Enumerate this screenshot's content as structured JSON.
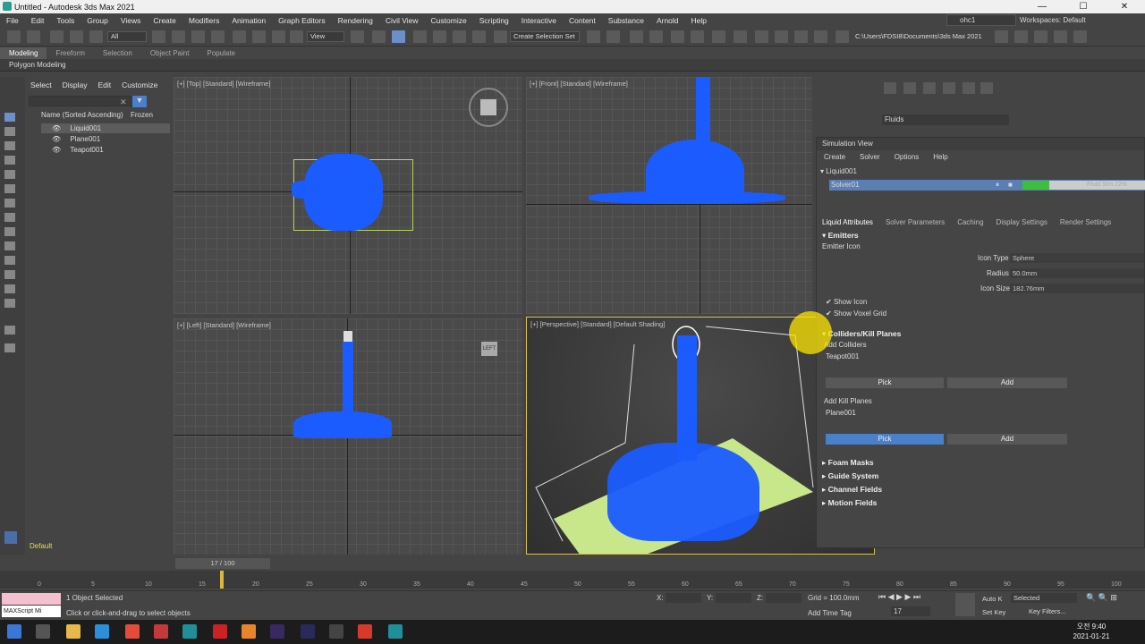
{
  "title": "Untitled - Autodesk 3ds Max 2021",
  "window_controls": [
    "—",
    "☐",
    "✕"
  ],
  "menu": [
    "File",
    "Edit",
    "Tools",
    "Group",
    "Views",
    "Create",
    "Modifiers",
    "Animation",
    "Graph Editors",
    "Rendering",
    "Civil View",
    "Customize",
    "Scripting",
    "Interactive",
    "Content",
    "Substance",
    "Arnold",
    "Help"
  ],
  "user": "ohc1",
  "workspace_label": "Workspaces:",
  "workspace_value": "Default",
  "toolbar": {
    "filter": "All",
    "view": "View",
    "selection_set": "Create Selection Set",
    "path": "C:\\Users\\FDSI8\\Documents\\3ds Max 2021"
  },
  "ribbon": {
    "tabs": [
      "Modeling",
      "Freeform",
      "Selection",
      "Object Paint",
      "Populate"
    ],
    "active": "Modeling",
    "sub": "Polygon Modeling"
  },
  "scene_explorer": {
    "menu": [
      "Select",
      "Display",
      "Edit",
      "Customize"
    ],
    "col_name": "Name (Sorted Ascending)",
    "col_frozen": "Frozen",
    "rows": [
      "Liquid001",
      "Plane001",
      "Teapot001"
    ],
    "layer": "Default"
  },
  "viewports": {
    "top": "[+] [Top] [Standard] [Wireframe]",
    "front": "[+] [Front] [Standard] [Wireframe]",
    "left": "[+] [Left] [Standard] [Wireframe]",
    "persp": "[+] [Perspective] [Standard] [Default Shading]",
    "viewcube_left": "LEFT"
  },
  "command_panel": {
    "category": "Fluids"
  },
  "sim_view": {
    "title": "Simulation View",
    "menu": [
      "Create",
      "Solver",
      "Options",
      "Help"
    ],
    "tree_parent": "Liquid001",
    "tree_child": "Solver01",
    "progress_fraction": 0.22,
    "progress_text": "Fluid Sim 22%",
    "tabs": [
      "Liquid Attributes",
      "Solver Parameters",
      "Caching",
      "Display Settings",
      "Render Settings"
    ],
    "emitters": {
      "head": "Emitters",
      "sub": "Emitter Icon",
      "icon_type_label": "Icon Type",
      "icon_type": "Sphere",
      "radius_label": "Radius",
      "radius": "50.0mm",
      "icon_size_label": "Icon Size",
      "icon_size": "182.76mm",
      "show_icon": "Show Icon",
      "show_voxel": "Show Voxel Grid"
    },
    "colliders": {
      "head": "Colliders/Kill Planes",
      "add_colliders": "Add Colliders",
      "collider_item": "Teapot001",
      "pick": "Pick",
      "add": "Add",
      "add_kill": "Add Kill Planes",
      "kill_item": "Plane001"
    },
    "sections": [
      "Foam Masks",
      "Guide System",
      "Channel Fields",
      "Motion Fields"
    ]
  },
  "timeline": {
    "frame": "17 / 100",
    "ticks": [
      "0",
      "5",
      "10",
      "15",
      "20",
      "25",
      "30",
      "35",
      "40",
      "45",
      "50",
      "55",
      "60",
      "65",
      "70",
      "75",
      "80",
      "85",
      "90",
      "95",
      "100"
    ]
  },
  "status": {
    "selection": "1 Object Selected",
    "hint": "Click or click-and-drag to select objects",
    "maxscript": "MAXScript Mi",
    "x_label": "X:",
    "y_label": "Y:",
    "z_label": "Z:",
    "grid": "Grid = 100.0mm",
    "add_time_tag": "Add Time Tag",
    "auto_key": "Auto K",
    "set_key": "Set Key",
    "selected": "Selected",
    "key_filters": "Key Filters...",
    "frame": "17"
  },
  "taskbar": {
    "time": "오전 9:40",
    "date": "2021-01-21"
  }
}
